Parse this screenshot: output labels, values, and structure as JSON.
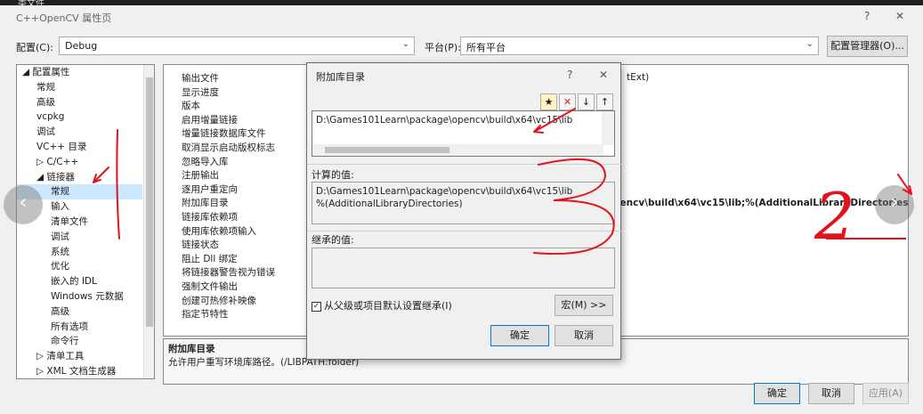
{
  "window": {
    "behind_title": "类文件",
    "title": "C++OpenCV 属性页",
    "help": "?",
    "close": "✕"
  },
  "config": {
    "config_label": "配置(C):",
    "config_value": "Debug",
    "platform_label": "平台(P):",
    "platform_value": "所有平台",
    "manager_button": "配置管理器(O)..."
  },
  "tree": {
    "items": [
      {
        "label": "◢ 配置属性",
        "indent": 0
      },
      {
        "label": "常规",
        "indent": 1
      },
      {
        "label": "高级",
        "indent": 1
      },
      {
        "label": "vcpkg",
        "indent": 1
      },
      {
        "label": "调试",
        "indent": 1
      },
      {
        "label": "VC++ 目录",
        "indent": 1
      },
      {
        "label": "▷ C/C++",
        "indent": 1
      },
      {
        "label": "◢ 链接器",
        "indent": 1
      },
      {
        "label": "常规",
        "indent": 2,
        "selected": true
      },
      {
        "label": "输入",
        "indent": 2
      },
      {
        "label": "清单文件",
        "indent": 2
      },
      {
        "label": "调试",
        "indent": 2
      },
      {
        "label": "系统",
        "indent": 2
      },
      {
        "label": "优化",
        "indent": 2
      },
      {
        "label": "嵌入的 IDL",
        "indent": 2
      },
      {
        "label": "Windows 元数据",
        "indent": 2
      },
      {
        "label": "高级",
        "indent": 2
      },
      {
        "label": "所有选项",
        "indent": 2
      },
      {
        "label": "命令行",
        "indent": 2
      },
      {
        "label": "▷ 清单工具",
        "indent": 1
      },
      {
        "label": "▷ XML 文档生成器",
        "indent": 1
      }
    ]
  },
  "properties": {
    "rows": [
      {
        "name": "输出文件",
        "value": ""
      },
      {
        "name": "显示进度",
        "value": ""
      },
      {
        "name": "版本",
        "value": ""
      },
      {
        "name": "启用增量链接",
        "value": ""
      },
      {
        "name": "增量链接数据库文件",
        "value": ""
      },
      {
        "name": "取消显示启动版权标志",
        "value": ""
      },
      {
        "name": "忽略导入库",
        "value": ""
      },
      {
        "name": "注册输出",
        "value": ""
      },
      {
        "name": "逐用户重定向",
        "value": ""
      },
      {
        "name": "附加库目录",
        "value": "pencv\\build\\x64\\vc15\\lib;%(AdditionalLibraryDirectories)"
      },
      {
        "name": "链接库依赖项",
        "value": ""
      },
      {
        "name": "使用库依赖项输入",
        "value": ""
      },
      {
        "name": "链接状态",
        "value": ""
      },
      {
        "name": "阻止 Dll 绑定",
        "value": ""
      },
      {
        "name": "将链接器警告视为错误",
        "value": ""
      },
      {
        "name": "强制文件输出",
        "value": ""
      },
      {
        "name": "创建可热修补映像",
        "value": ""
      },
      {
        "name": "指定节特性",
        "value": ""
      }
    ],
    "first_row_tail": "tExt)"
  },
  "description": {
    "heading": "附加库目录",
    "text": "允许用户重写环境库路径。(/LIBPATH:folder)"
  },
  "footer": {
    "ok": "确定",
    "cancel": "取消",
    "apply": "应用(A)"
  },
  "dialog": {
    "title": "附加库目录",
    "help": "?",
    "close": "✕",
    "list_entry": "D:\\Games101Learn\\package\\opencv\\build\\x64\\vc15\\lib",
    "computed_label": "计算的值:",
    "computed_line1": "D:\\Games101Learn\\package\\opencv\\build\\x64\\vc15\\lib",
    "computed_line2": "%(AdditionalLibraryDirectories)",
    "inherited_label": "继承的值:",
    "inherit_checkbox": "从父级或项目默认设置继承(I)",
    "inherit_checked": true,
    "macro_button": "宏(M) >>",
    "ok": "确定",
    "cancel": "取消"
  },
  "annotations": {
    "handwritten_number": "2",
    "color": "#e0141e"
  }
}
